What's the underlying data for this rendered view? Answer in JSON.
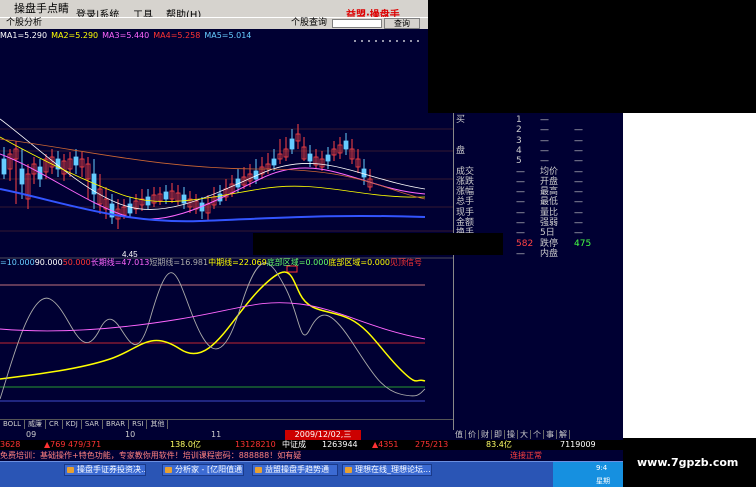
{
  "window": {
    "title": "操盘手点睛"
  },
  "menu": {
    "items": [
      "登录|系统",
      "工具",
      "帮助(H)"
    ]
  },
  "toolbar": {
    "tab_label": "个股分析",
    "search_label": "个股查询",
    "search_value": "",
    "search_button": "查询",
    "brand": "益盟·操盘手"
  },
  "ma_line": {
    "items": [
      {
        "text": "MA1=5.290",
        "color": "#ffffff"
      },
      {
        "text": "MA2=5.290",
        "color": "#ffff00"
      },
      {
        "text": "MA3=5.440",
        "color": "#ff66ff"
      },
      {
        "text": "MA4=5.258",
        "color": "#ff3333"
      },
      {
        "text": "MA5=5.014",
        "color": "#66ccff"
      }
    ]
  },
  "price_chart": {
    "low_label": "4.45"
  },
  "indicator_line": {
    "items": [
      {
        "text": "=10.000",
        "color": "#66ccff"
      },
      {
        "text": "90.000",
        "color": "#ffffff"
      },
      {
        "text": "50.000",
        "color": "#ff3333"
      },
      {
        "text": "长期线=47.013",
        "color": "#ff66ff"
      },
      {
        "text": "短期线=16.981",
        "color": "#aaaaaa"
      },
      {
        "text": "中期线=22.069",
        "color": "#ffff00"
      },
      {
        "text": "底部区域=0.000",
        "color": "#66ff66"
      },
      {
        "text": "底部区域=0.000",
        "color": "#ffff00"
      },
      {
        "text": "见顶信号",
        "color": "#ff3333"
      }
    ]
  },
  "bottom_tabs": [
    "BOLL",
    "威廉",
    "CR",
    "KDJ",
    "SAR",
    "BRAR",
    "RSI",
    "其他"
  ],
  "date_axis": {
    "labels": [
      "09",
      "10",
      "11"
    ],
    "cursor": "2009/12/02,三"
  },
  "right_panel": {
    "rows": [
      {
        "c1": "买",
        "c2": "1",
        "c3": "—",
        "c4": ""
      },
      {
        "c1": "",
        "c2": "2",
        "c3": "—",
        "c4": "—"
      },
      {
        "c1": "",
        "c2": "3",
        "c3": "—",
        "c4": "—"
      },
      {
        "c1": "盘",
        "c2": "4",
        "c3": "—",
        "c4": "—"
      },
      {
        "c1": "",
        "c2": "5",
        "c3": "—",
        "c4": "—"
      },
      {
        "c1": "成交",
        "c2": "—",
        "c3": "均价",
        "c4": "—"
      },
      {
        "c1": "涨跌",
        "c2": "—",
        "c3": "开盘",
        "c4": "—"
      },
      {
        "c1": "涨幅",
        "c2": "—",
        "c3": "最高",
        "c4": "—"
      },
      {
        "c1": "总手",
        "c2": "—",
        "c3": "最低",
        "c4": "—"
      },
      {
        "c1": "现手",
        "c2": "—",
        "c3": "量比",
        "c4": "—"
      },
      {
        "c1": "金额",
        "c2": "—",
        "c3": "强弱",
        "c4": "—"
      },
      {
        "c1": "换手",
        "c2": "—",
        "c3": "5日",
        "c4": "—"
      },
      {
        "c1": "",
        "c2": "582",
        "c3": "跌停",
        "c4": "475"
      },
      {
        "c1": "",
        "c2": "—",
        "c3": "内盘",
        "c4": ""
      }
    ],
    "tabs": [
      "值",
      "价",
      "财",
      "即",
      "操",
      "大",
      "个",
      "事",
      "解"
    ]
  },
  "status_line": {
    "items": [
      {
        "text": "3628",
        "color": "#ff3333"
      },
      {
        "text": "▲769 479/371",
        "color": "#ff3333"
      },
      {
        "text": "138.0亿",
        "color": "#ffff66"
      },
      {
        "text": "13128210",
        "color": "#ff3333"
      },
      {
        "text": "中证成",
        "color": "#ffffff"
      },
      {
        "text": "1263944",
        "color": "#ffffff"
      },
      {
        "text": "▲4351",
        "color": "#ff3333"
      },
      {
        "text": "275/213",
        "color": "#ff3333"
      },
      {
        "text": "83.4亿",
        "color": "#ffff66"
      },
      {
        "text": "7119009",
        "color": "#ffffff"
      }
    ]
  },
  "news_line": {
    "text": "免费培训：基础操作+特色功能，专家教你用软件！培训课程密码：888888！如有疑",
    "tray": "连接正常"
  },
  "taskbar": {
    "items": [
      "操盘手证券投资决...",
      "分析家 - [亿阳值通]",
      "益盟操盘手趋势通",
      "理想在线_理想论坛..."
    ]
  },
  "clock": {
    "time": "9:4",
    "day": "星期"
  },
  "watermark": "www.7gpzb.com"
}
